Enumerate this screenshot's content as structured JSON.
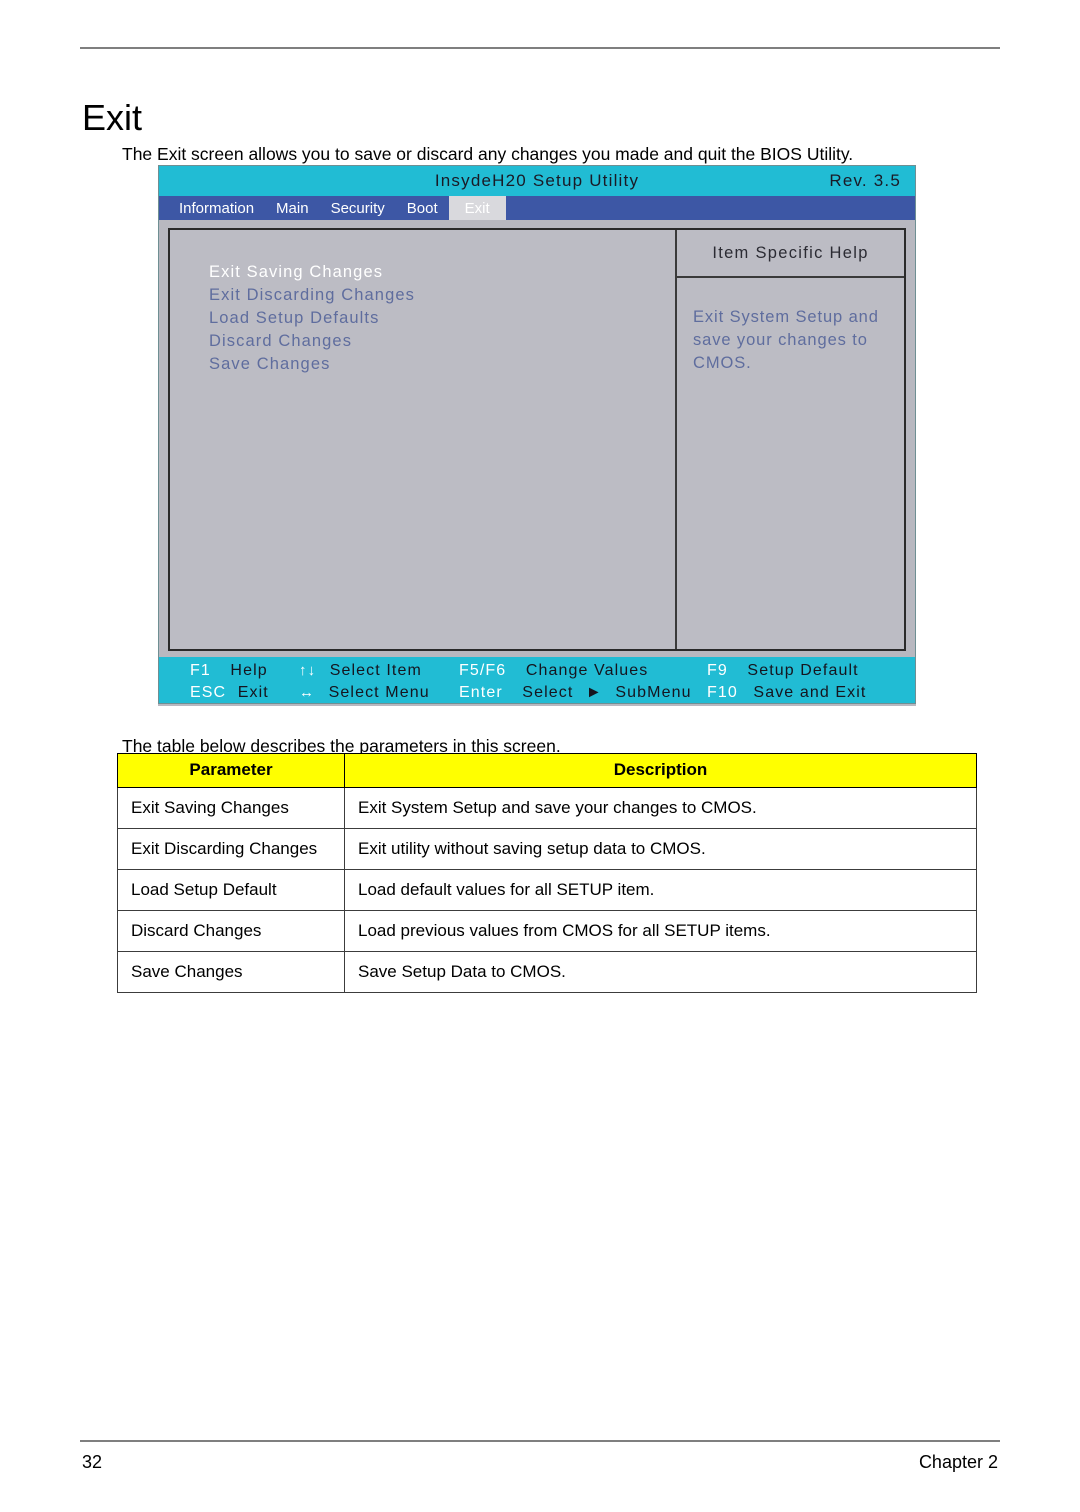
{
  "page": {
    "title": "Exit",
    "intro": "The Exit screen allows you to save or discard any changes you made and quit the BIOS Utility.",
    "table_caption": "The table below describes the parameters in this screen.",
    "footer_page_number": "32",
    "footer_chapter": "Chapter 2"
  },
  "bios": {
    "title": "InsydeH20 Setup Utility",
    "revision": "Rev. 3.5",
    "tabs": [
      {
        "label": "Information",
        "active": false
      },
      {
        "label": "Main",
        "active": false
      },
      {
        "label": "Security",
        "active": false
      },
      {
        "label": "Boot",
        "active": false
      },
      {
        "label": "Exit",
        "active": true
      }
    ],
    "menu_items": [
      {
        "label": "Exit Saving Changes",
        "selected": true
      },
      {
        "label": "Exit Discarding Changes",
        "selected": false
      },
      {
        "label": "Load Setup Defaults",
        "selected": false
      },
      {
        "label": "Discard Changes",
        "selected": false
      },
      {
        "label": "Save Changes",
        "selected": false
      }
    ],
    "help": {
      "title": "Item Specific Help",
      "line1": "Exit System Setup and",
      "line2": "save your changes to",
      "line3": "CMOS."
    },
    "function_keys": {
      "row1": {
        "c1_key": "F1",
        "c1_label": "Help",
        "c2_arrow": "↑↓",
        "c2_label": "Select  Item",
        "c3_key": "F5/F6",
        "c3_label": "Change Values",
        "c4_key": "F9",
        "c4_label": "Setup Default"
      },
      "row2": {
        "c1_key": "ESC",
        "c1_label": "Exit",
        "c2_arrow": "↔",
        "c2_label": "Select  Menu",
        "c3_key": "Enter",
        "c3_label_pre": "Select",
        "c3_arrow": "►",
        "c3_label_post": "SubMenu",
        "c4_key": "F10",
        "c4_label": "Save and Exit"
      }
    },
    "colors": {
      "title_bar": "#21bcd4",
      "tab_bar": "#3d57a5",
      "active_tab": "#d9d9dd",
      "body": "#b8b8c0",
      "menu_text": "#5f6d9e",
      "selected_text": "#ffffff"
    }
  },
  "table": {
    "headers": {
      "parameter": "Parameter",
      "description": "Description"
    },
    "rows": [
      {
        "parameter": "Exit Saving Changes",
        "description": "Exit System Setup and save your changes to CMOS."
      },
      {
        "parameter": "Exit Discarding Changes",
        "description": "Exit utility without saving setup data to CMOS."
      },
      {
        "parameter": "Load Setup Default",
        "description": "Load default values for all SETUP item."
      },
      {
        "parameter": "Discard Changes",
        "description": "Load previous values from CMOS for all SETUP items."
      },
      {
        "parameter": "Save Changes",
        "description": "Save Setup Data to CMOS."
      }
    ],
    "header_color": "#ffff00"
  }
}
